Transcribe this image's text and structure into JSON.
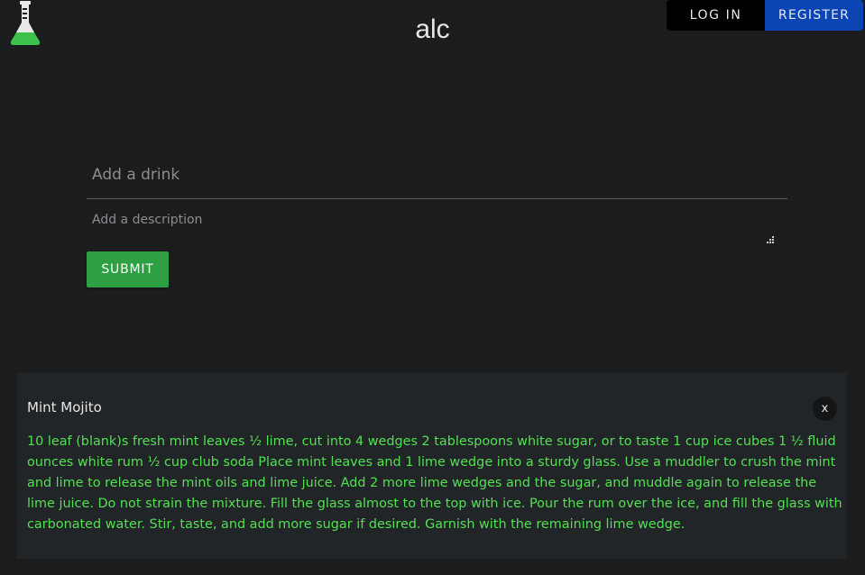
{
  "header": {
    "title": "alc",
    "login_label": "LOG IN",
    "register_label": "REGISTER",
    "logo_icon": "flask-icon"
  },
  "form": {
    "drink_placeholder": "Add a drink",
    "description_placeholder": "Add a description",
    "submit_label": "SUBMIT"
  },
  "drinks": [
    {
      "name": "Mint Mojito",
      "close_label": "x",
      "description": "10 leaf (blank)s fresh mint leaves ½ lime, cut into 4 wedges 2 tablespoons white sugar, or to taste 1 cup ice cubes 1 ½ fluid ounces white rum ½ cup club soda Place mint leaves and 1 lime wedge into a sturdy glass. Use a muddler to crush the mint and lime to release the mint oils and lime juice. Add 2 more lime wedges and the sugar, and muddle again to release the lime juice. Do not strain the mixture. Fill the glass almost to the top with ice. Pour the rum over the ice, and fill the glass with carbonated water. Stir, taste, and add more sugar if desired. Garnish with the remaining lime wedge."
    }
  ],
  "colors": {
    "background": "#1b1c1e",
    "card_background": "#222528",
    "register_button": "#0a44b5",
    "login_button": "#000000",
    "submit_button": "#2ea043",
    "description_text": "#52e052",
    "logo_liquid": "#3cc24a"
  }
}
